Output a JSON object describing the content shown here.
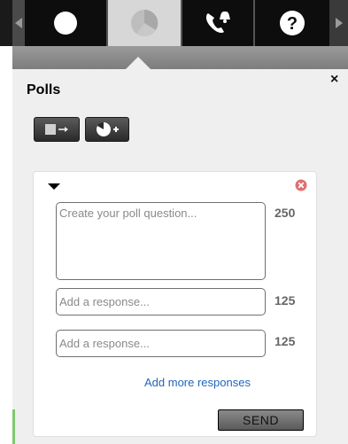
{
  "toolbar": {
    "icons": [
      "left-arrow-icon",
      "circle-icon",
      "pie-chart-icon",
      "phone-bell-icon",
      "help-icon",
      "right-arrow-icon"
    ],
    "active_tab": "polls"
  },
  "panel": {
    "title": "Polls",
    "close_label": "×"
  },
  "poll": {
    "question_placeholder": "Create your poll question...",
    "question_limit": "250",
    "responses": [
      {
        "placeholder": "Add a response...",
        "limit": "125"
      },
      {
        "placeholder": "Add a response...",
        "limit": "125"
      }
    ],
    "add_more_label": "Add more responses",
    "send_label": "SEND"
  },
  "colors": {
    "toolbar_bg": "#0d0d0d",
    "active_tab_bg": "#d7d7d7",
    "panel_bg": "#efefef",
    "link": "#2266bb",
    "remove": "#e07070"
  }
}
